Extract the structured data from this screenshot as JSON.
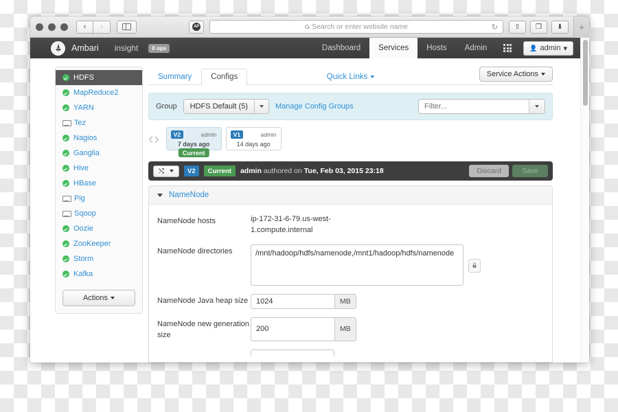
{
  "browser": {
    "back_icon": "‹",
    "forward_icon": "›",
    "sidebar_toggle_name": "sidebar-toggle",
    "favicon_text": "AP",
    "url_placeholder": "Search or enter website name",
    "url_value": "",
    "reload_icon": "↻",
    "share_icon": "⇧",
    "tabs_icon": "❐",
    "download_icon": "⬇",
    "new_tab_icon": "+"
  },
  "navbar": {
    "brand": "Ambari",
    "insight": "insight",
    "ops_badge": "0 ops",
    "links": [
      {
        "label": "Dashboard",
        "active": false
      },
      {
        "label": "Services",
        "active": true
      },
      {
        "label": "Hosts",
        "active": false
      },
      {
        "label": "Admin",
        "active": false
      }
    ],
    "user_label": "admin",
    "user_caret": "▾"
  },
  "sidebar": {
    "items": [
      {
        "label": "HDFS",
        "icon": "status-ok-icon",
        "active": true
      },
      {
        "label": "MapReduce2",
        "icon": "status-ok-icon",
        "active": false
      },
      {
        "label": "YARN",
        "icon": "status-ok-icon",
        "active": false
      },
      {
        "label": "Tez",
        "icon": "client-monitor-icon",
        "active": false
      },
      {
        "label": "Nagios",
        "icon": "status-ok-icon",
        "active": false
      },
      {
        "label": "Ganglia",
        "icon": "status-ok-icon",
        "active": false
      },
      {
        "label": "Hive",
        "icon": "status-ok-icon",
        "active": false
      },
      {
        "label": "HBase",
        "icon": "status-ok-icon",
        "active": false
      },
      {
        "label": "Pig",
        "icon": "client-monitor-icon",
        "active": false
      },
      {
        "label": "Sqoop",
        "icon": "client-monitor-icon",
        "active": false
      },
      {
        "label": "Oozie",
        "icon": "status-ok-icon",
        "active": false
      },
      {
        "label": "ZooKeeper",
        "icon": "status-ok-icon",
        "active": false
      },
      {
        "label": "Storm",
        "icon": "status-ok-icon",
        "active": false
      },
      {
        "label": "Kafka",
        "icon": "status-ok-icon",
        "active": false
      }
    ],
    "actions_label": "Actions"
  },
  "main": {
    "tabs": [
      {
        "label": "Summary",
        "active": false
      },
      {
        "label": "Configs",
        "active": true
      }
    ],
    "quick_links": "Quick Links",
    "service_actions": "Service Actions",
    "group": {
      "label": "Group",
      "selected": "HDFS Default (5)",
      "manage_link": "Manage Config Groups",
      "filter_placeholder": "Filter...",
      "filter_value": ""
    },
    "versions": {
      "prev_icon": "‹",
      "next_icon": "›",
      "cards": [
        {
          "version": "V2",
          "author": "admin",
          "time": "7 days ago",
          "current": true,
          "current_label": "Current"
        },
        {
          "version": "V1",
          "author": "admin",
          "time": "14 days ago",
          "current": false,
          "current_label": ""
        }
      ]
    },
    "config_bar": {
      "compare_icon": "⤭",
      "version": "V2",
      "current_label": "Current",
      "author": "admin",
      "authored_text": "authored on",
      "timestamp": "Tue, Feb 03, 2015 23:18",
      "discard_label": "Discard",
      "save_label": "Save"
    },
    "panel": {
      "title": "NameNode",
      "fields": [
        {
          "label": "NameNode hosts",
          "type": "text",
          "value": "ip-172-31-6-79.us-west-1.compute.internal"
        },
        {
          "label": "NameNode directories",
          "type": "textarea",
          "value": "/mnt/hadoop/hdfs/namenode,/mnt1/hadoop/hdfs/namenode",
          "lock_icon": "lock-icon"
        },
        {
          "label": "NameNode Java heap size",
          "type": "number",
          "value": "1024",
          "unit": "MB"
        },
        {
          "label": "NameNode new generation size",
          "type": "number",
          "value": "200",
          "unit": "MB"
        }
      ]
    }
  },
  "colors": {
    "link": "#2f8fd4",
    "ok_green": "#45bd5f",
    "current_green": "#4a9a52",
    "version_blue": "#2b7bb9",
    "navbar_dark": "#3b3b3b",
    "group_bar": "#dff0f5"
  }
}
